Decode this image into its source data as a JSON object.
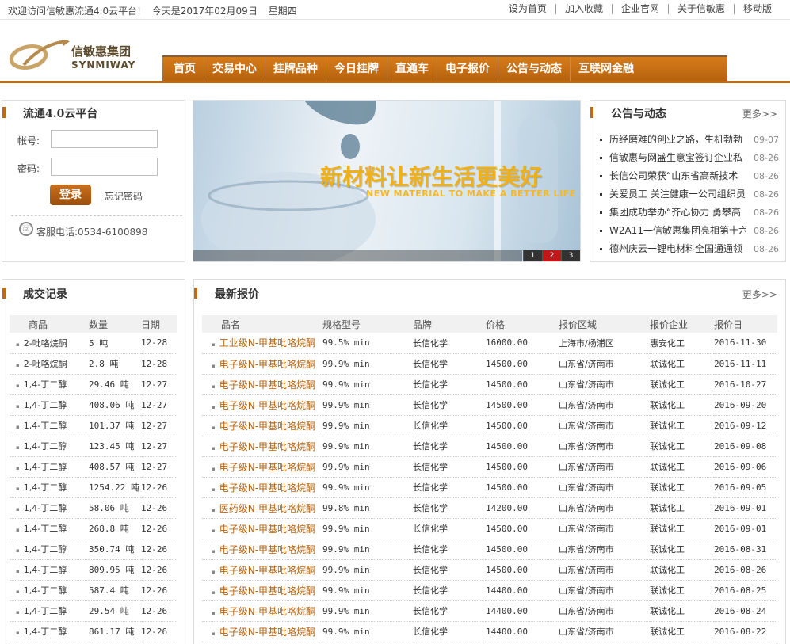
{
  "topbar": {
    "welcome": "欢迎访问信敏惠流通4.0云平台!",
    "date": "今天是2017年02月09日",
    "weekday": "星期四",
    "links": [
      "设为首页",
      "加入收藏",
      "企业官网",
      "关于信敏惠",
      "移动版"
    ]
  },
  "logo": {
    "cn": "信敏惠集团",
    "en": "SYNMIWAY"
  },
  "nav": [
    "首页",
    "交易中心",
    "挂牌品种",
    "今日挂牌",
    "直通车",
    "电子报价",
    "公告与动态",
    "互联网金融"
  ],
  "login": {
    "title": "流通4.0云平台",
    "account_label": "帐号:",
    "password_label": "密码:",
    "login_button": "登录",
    "forgot": "忘记密码",
    "phone": "客服电话:0534-6100898"
  },
  "banner": {
    "headline": "新材料让新生活更美好",
    "sub": "NEW MATERIAL TO MAKE A BETTER LIFE",
    "pages": [
      "1",
      "2",
      "3"
    ],
    "active_page": "2"
  },
  "news": {
    "title": "公告与动态",
    "more": "更多>>",
    "items": [
      {
        "t": "历经磨难的创业之路，生机勃勃",
        "d": "09-07"
      },
      {
        "t": "信敏惠与网盛生意宝签订企业私",
        "d": "08-26"
      },
      {
        "t": "长信公司荣获“山东省高新技术",
        "d": "08-26"
      },
      {
        "t": "关爱员工  关注健康一公司组织员",
        "d": "08-26"
      },
      {
        "t": "集团成功举办“齐心协力  勇攀高",
        "d": "08-26"
      },
      {
        "t": "W2A11一信敏惠集团亮相第十六届",
        "d": "08-26"
      },
      {
        "t": "德州庆云一锂电材料全国通通领",
        "d": "08-26"
      }
    ]
  },
  "deals": {
    "title": "成交记录",
    "headers": [
      "商品",
      "数量",
      "日期"
    ],
    "rows": [
      [
        "2-吡咯烷酮",
        "5 吨",
        "12-28"
      ],
      [
        "2-吡咯烷酮",
        "2.8 吨",
        "12-28"
      ],
      [
        "1,4-丁二醇",
        "29.46 吨",
        "12-27"
      ],
      [
        "1,4-丁二醇",
        "408.06 吨",
        "12-27"
      ],
      [
        "1,4-丁二醇",
        "101.37 吨",
        "12-27"
      ],
      [
        "1,4-丁二醇",
        "123.45 吨",
        "12-27"
      ],
      [
        "1,4-丁二醇",
        "408.57 吨",
        "12-27"
      ],
      [
        "1,4-丁二醇",
        "1254.22 吨",
        "12-26"
      ],
      [
        "1,4-丁二醇",
        "58.06 吨",
        "12-26"
      ],
      [
        "1,4-丁二醇",
        "268.8 吨",
        "12-26"
      ],
      [
        "1,4-丁二醇",
        "350.74 吨",
        "12-26"
      ],
      [
        "1,4-丁二醇",
        "809.95 吨",
        "12-26"
      ],
      [
        "1,4-丁二醇",
        "587.4 吨",
        "12-26"
      ],
      [
        "1,4-丁二醇",
        "29.54 吨",
        "12-26"
      ],
      [
        "1,4-丁二醇",
        "861.17 吨",
        "12-26"
      ]
    ]
  },
  "quotes": {
    "title": "最新报价",
    "more": "更多>>",
    "headers": [
      "品名",
      "规格型号",
      "品牌",
      "价格",
      "报价区域",
      "报价企业",
      "报价日"
    ],
    "rows": [
      [
        "工业级N-甲基吡咯烷酮",
        "99.5% min",
        "长信化学",
        "16000.00",
        "上海市/杨浦区",
        "惠安化工",
        "2016-11-30"
      ],
      [
        "电子级N-甲基吡咯烷酮",
        "99.9% min",
        "长信化学",
        "14500.00",
        "山东省/济南市",
        "联诚化工",
        "2016-11-11"
      ],
      [
        "电子级N-甲基吡咯烷酮",
        "99.9% min",
        "长信化学",
        "14500.00",
        "山东省/济南市",
        "联诚化工",
        "2016-10-27"
      ],
      [
        "电子级N-甲基吡咯烷酮",
        "99.9% min",
        "长信化学",
        "14500.00",
        "山东省/济南市",
        "联诚化工",
        "2016-09-20"
      ],
      [
        "电子级N-甲基吡咯烷酮",
        "99.9% min",
        "长信化学",
        "14500.00",
        "山东省/济南市",
        "联诚化工",
        "2016-09-12"
      ],
      [
        "电子级N-甲基吡咯烷酮",
        "99.9% min",
        "长信化学",
        "14500.00",
        "山东省/济南市",
        "联诚化工",
        "2016-09-08"
      ],
      [
        "电子级N-甲基吡咯烷酮",
        "99.9% min",
        "长信化学",
        "14500.00",
        "山东省/济南市",
        "联诚化工",
        "2016-09-06"
      ],
      [
        "电子级N-甲基吡咯烷酮",
        "99.9% min",
        "长信化学",
        "14500.00",
        "山东省/济南市",
        "联诚化工",
        "2016-09-05"
      ],
      [
        "医药级N-甲基吡咯烷酮",
        "99.8% min",
        "长信化学",
        "14200.00",
        "山东省/济南市",
        "联诚化工",
        "2016-09-01"
      ],
      [
        "电子级N-甲基吡咯烷酮",
        "99.9% min",
        "长信化学",
        "14500.00",
        "山东省/济南市",
        "联诚化工",
        "2016-09-01"
      ],
      [
        "电子级N-甲基吡咯烷酮",
        "99.9% min",
        "长信化学",
        "14500.00",
        "山东省/济南市",
        "联诚化工",
        "2016-08-31"
      ],
      [
        "电子级N-甲基吡咯烷酮",
        "99.9% min",
        "长信化学",
        "14500.00",
        "山东省/济南市",
        "联诚化工",
        "2016-08-26"
      ],
      [
        "电子级N-甲基吡咯烷酮",
        "99.9% min",
        "长信化学",
        "14400.00",
        "山东省/济南市",
        "联诚化工",
        "2016-08-25"
      ],
      [
        "电子级N-甲基吡咯烷酮",
        "99.9% min",
        "长信化学",
        "14400.00",
        "山东省/济南市",
        "联诚化工",
        "2016-08-24"
      ],
      [
        "电子级N-甲基吡咯烷酮",
        "99.9% min",
        "长信化学",
        "14400.00",
        "山东省/济南市",
        "联诚化工",
        "2016-08-22"
      ]
    ]
  },
  "colors": {
    "accent": "#c06a12",
    "nav_bg": "#c7701a",
    "link_orange": "#b7640f"
  }
}
